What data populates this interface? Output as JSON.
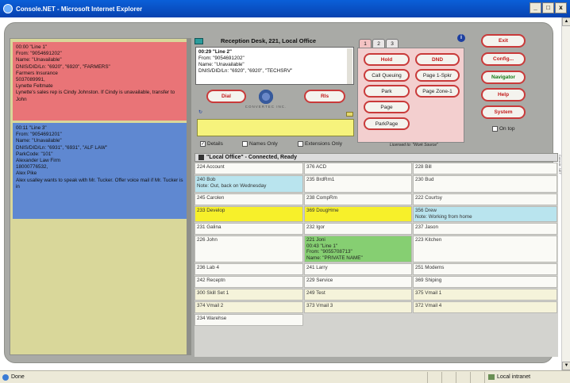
{
  "window": {
    "title": "Console.NET - Microsoft Internet Explorer",
    "min": "_",
    "max": "□",
    "close": "x"
  },
  "status_bar": {
    "left": "Done",
    "zone": "Local intranet"
  },
  "calls": [
    {
      "lines": [
        "00:00 \"Line 1\"",
        "From: \"9054691202\"",
        "Name: \"Unavailable\"",
        "DNIS/DID/Ln: \"6920\", \"6920\", \"FARMERS\"",
        "Farmers Insurance",
        "5037089991,",
        "Lynette Feltmate"
      ],
      "note": "Lynette's sales rep is Cindy Johnston.  If Cindy is unavailable, transfer to John"
    },
    {
      "lines": [
        "00:11 \"Line 3\"",
        "From: \"9054691201\"",
        "Name: \"Unavailable\"",
        "DNIS/DID/Ln: \"6931\", \"6931\", \"ALF LAW\"",
        "ParkCode: \"101\"",
        "Alexander Law Firm",
        "18000776532,",
        "Alex Pike"
      ],
      "note": "Alex usalley wants to speak with Mr. Tucker.  Offer voice mail if Mr. Tucker is in"
    }
  ],
  "header": {
    "title": "Reception Desk,   221, Local Office"
  },
  "current_call": {
    "line1": "00:29 \"Line 2\"",
    "line2": "From: \"9054691202\"",
    "line3": "Name: \"Unavailable\"",
    "line4": "DNIS/DID/Ln: \"6920\", \"6920\", \"TECHSRV\""
  },
  "buttons": {
    "dial": "Dial",
    "rls": "Rls",
    "hold": "Hold",
    "dnd": "DND",
    "call_queuing": "Call Queuing",
    "page_1_spkr": "Page 1-Spkr",
    "park": "Park",
    "page_zone_1": "Page Zone-1",
    "page": "Page",
    "park_page": "ParkPage",
    "exit": "Exit",
    "config": "Config...",
    "navigator": "Navigator",
    "help": "Help",
    "system": "System"
  },
  "tabs": [
    "1",
    "2",
    "3"
  ],
  "logo_text": "CONVERTEC INC.",
  "options": {
    "details": "Details",
    "names_only": "Names Only",
    "extensions_only": "Extensions Only",
    "on_top": "On top"
  },
  "licensed_to": "Licensed to: \"Work Source\"",
  "table_title": "\"Local Office\" - Connected, Ready",
  "side_label": "Console .NET",
  "extensions": [
    [
      "224 Account",
      "376 ACD",
      "228 Bill"
    ],
    [
      "240 Bob\nNote: Out, back on Wednesday",
      "235 BrdRm1",
      "230 Bud"
    ],
    [
      "245 Carolen",
      "238 CompRm",
      "222 Courtsy"
    ],
    [
      "233 Develop",
      "369 DougHme",
      "356 Drew\nNote: Working from home"
    ],
    [
      "231 Galina",
      "232 Igor",
      "237 Jason"
    ],
    [
      "226 John",
      "221 Joni\n00:43 \"Line 1\"\nFrom: \"9055708713\"\nName: \"PRIVATE NAME\"",
      "223 Kitchen"
    ],
    [
      "236 Lab 4",
      "241 Larry",
      "251 Modems"
    ],
    [
      "242 Receptn",
      "229 Service",
      "369 Shiping"
    ],
    [
      "300 Skill Set 1",
      "249 Test",
      "375 Vmail 1"
    ],
    [
      "374 Vmail 2",
      "373 Vmail 3",
      "372 Vmail 4"
    ],
    [
      "234 Warehse",
      "",
      ""
    ]
  ]
}
